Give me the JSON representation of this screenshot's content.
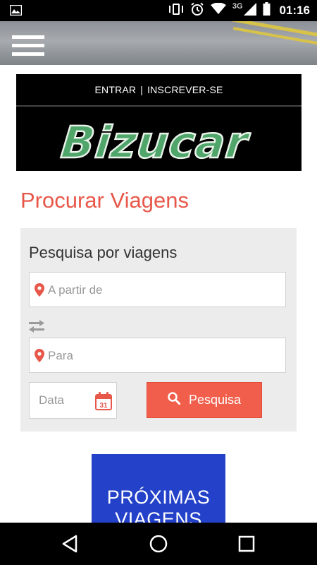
{
  "status_bar": {
    "time": "01:16",
    "network": "3G",
    "icons": [
      "image-notification-icon",
      "vibrate-icon",
      "alarm-icon",
      "wifi-icon",
      "signal-icon",
      "battery-icon"
    ]
  },
  "header": {
    "menu_icon": "hamburger-menu-icon"
  },
  "logo_block": {
    "login_label": "ENTRAR",
    "separator": "|",
    "signup_label": "INSCREVER-SE",
    "brand": "Bizucar"
  },
  "page": {
    "title": "Procurar Viagens"
  },
  "search": {
    "heading": "Pesquisa por viagens",
    "from_placeholder": "A partir de",
    "to_placeholder": "Para",
    "date_placeholder": "Data",
    "calendar_day": "31",
    "button_label": "Pesquisa"
  },
  "promo": {
    "line1": "PRÓXIMAS",
    "line2": "VIAGENS"
  },
  "colors": {
    "accent": "#e8584a",
    "button": "#f15f4c",
    "logo_green": "#4fa56a",
    "promo_blue": "#2442c9",
    "panel": "#ececec"
  }
}
